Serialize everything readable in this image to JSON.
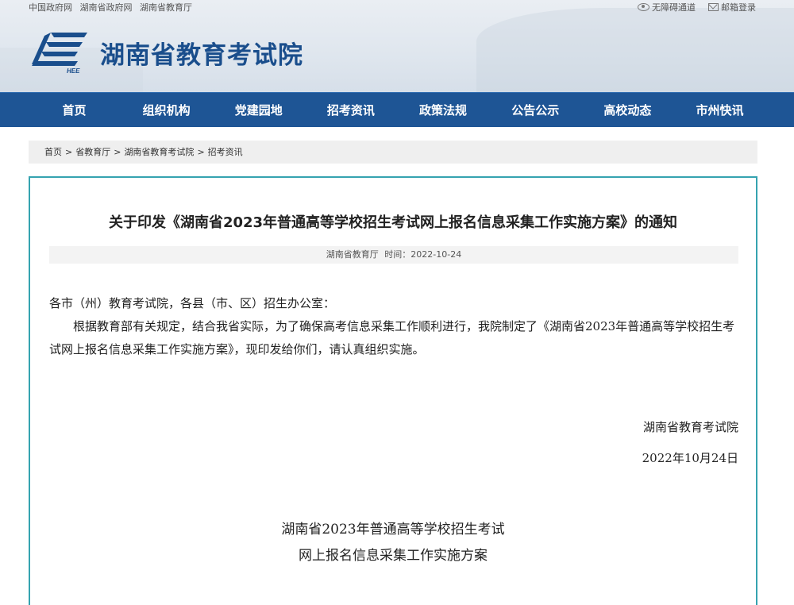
{
  "top_links": [
    "中国政府网",
    "湖南省政府网",
    "湖南省教育厅"
  ],
  "top_right": {
    "accessibility": "无障碍通道",
    "mail_login": "邮箱登录"
  },
  "site": {
    "title": "湖南省教育考试院",
    "logo_text": "HEE"
  },
  "nav": {
    "items": [
      "首页",
      "组织机构",
      "党建园地",
      "招考资讯",
      "政策法规",
      "公告公示",
      "高校动态",
      "市州快讯"
    ]
  },
  "breadcrumb": [
    "首页",
    "省教育厅",
    "湖南省教育考试院",
    "招考资讯"
  ],
  "breadcrumb_sep": ">",
  "article": {
    "title": "关于印发《湖南省2023年普通高等学校招生考试网上报名信息采集工作实施方案》的通知",
    "source": "湖南省教育厅",
    "time_label": "时间：",
    "time": "2022-10-24",
    "salutation": "各市（州）教育考试院，各县（市、区）招生办公室：",
    "paragraph": "根据教育部有关规定，结合我省实际，为了确保高考信息采集工作顺利进行，我院制定了《湖南省2023年普通高等学校招生考试网上报名信息采集工作实施方案》，现印发给你们，请认真组织实施。",
    "sign_org": "湖南省教育考试院",
    "sign_date": "2022年10月24日",
    "plan_title_1": "湖南省2023年普通高等学校招生考试",
    "plan_title_2": "网上报名信息采集工作实施方案"
  },
  "colors": {
    "nav_bg": "#1e5595",
    "title_blue": "#1a4e8c",
    "content_border": "#35a3b0"
  }
}
